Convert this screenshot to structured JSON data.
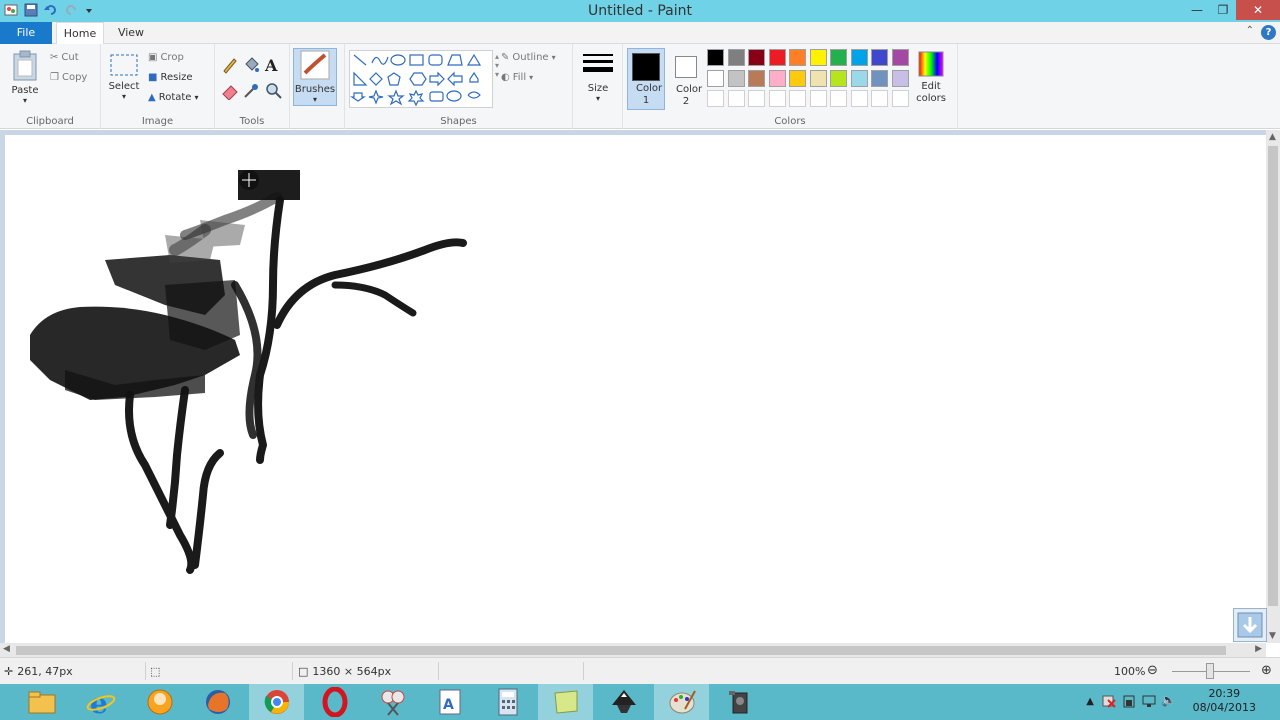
{
  "window": {
    "title": "Untitled - Paint"
  },
  "tabs": {
    "file": "File",
    "home": "Home",
    "view": "View"
  },
  "clipboard": {
    "paste": "Paste",
    "cut": "Cut",
    "copy": "Copy",
    "label": "Clipboard"
  },
  "image": {
    "select": "Select",
    "crop": "Crop",
    "resize": "Resize",
    "rotate": "Rotate",
    "label": "Image"
  },
  "tools": {
    "label": "Tools"
  },
  "brushes": {
    "label": "Brushes"
  },
  "shapes": {
    "outline": "Outline",
    "fill": "Fill",
    "label": "Shapes"
  },
  "size": {
    "label": "Size"
  },
  "colors": {
    "color1_label": "Color 1",
    "color2_label": "Color 2",
    "edit_colors": "Edit colors",
    "label": "Colors",
    "color1": "#000000",
    "color2": "#ffffff",
    "palette_row1": [
      "#000000",
      "#7f7f7f",
      "#880015",
      "#ed1c24",
      "#ff7f27",
      "#fff200",
      "#22b14c",
      "#00a2e8",
      "#3f48cc",
      "#a349a4"
    ],
    "palette_row2": [
      "#ffffff",
      "#c3c3c3",
      "#b97a57",
      "#ffaec9",
      "#ffc90e",
      "#efe4b0",
      "#b5e61d",
      "#99d9ea",
      "#7092be",
      "#c8bfe7"
    ]
  },
  "status": {
    "cursor_pos": "261, 47px",
    "canvas_size": "1360 × 564px",
    "zoom": "100%"
  },
  "clock": {
    "time": "20:39",
    "date": "08/04/2013"
  }
}
